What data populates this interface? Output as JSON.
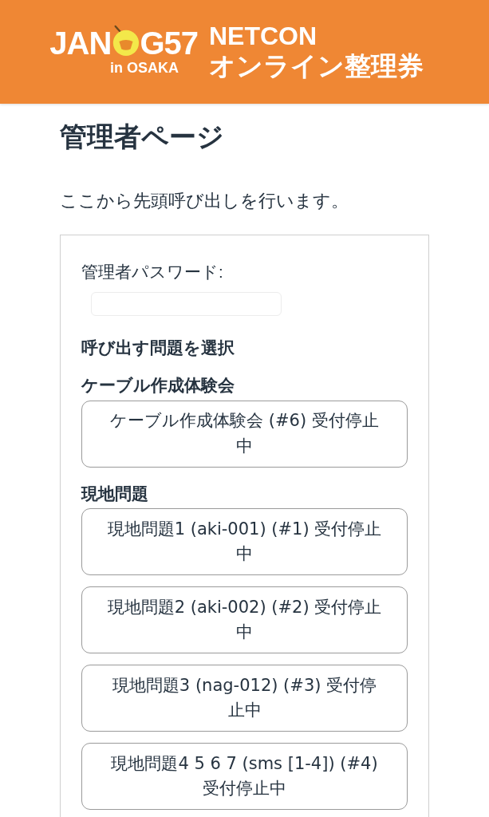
{
  "header": {
    "logo": {
      "text_before": "JAN",
      "text_after": "G57",
      "subtitle": "in OSAKA"
    },
    "title_line1": "NETCON",
    "title_line2": "オンライン整理券"
  },
  "page": {
    "title": "管理者ページ",
    "intro": "ここから先頭呼び出しを行います。"
  },
  "form": {
    "password_label": "管理者パスワード:",
    "select_heading": "呼び出す問題を選択",
    "groups": [
      {
        "heading": "ケーブル作成体験会",
        "buttons": [
          {
            "label": "ケーブル作成体験会 (#6) 受付停止中"
          }
        ]
      },
      {
        "heading": "現地問題",
        "buttons": [
          {
            "label": "現地問題1 (aki-001) (#1) 受付停止中"
          },
          {
            "label": "現地問題2 (aki-002) (#2) 受付停止中"
          },
          {
            "label": "現地問題3 (nag-012) (#3) 受付停止中"
          },
          {
            "label": "現地問題4 5 6 7 (sms [1-4]) (#4) 受付停止中"
          }
        ]
      }
    ]
  }
}
